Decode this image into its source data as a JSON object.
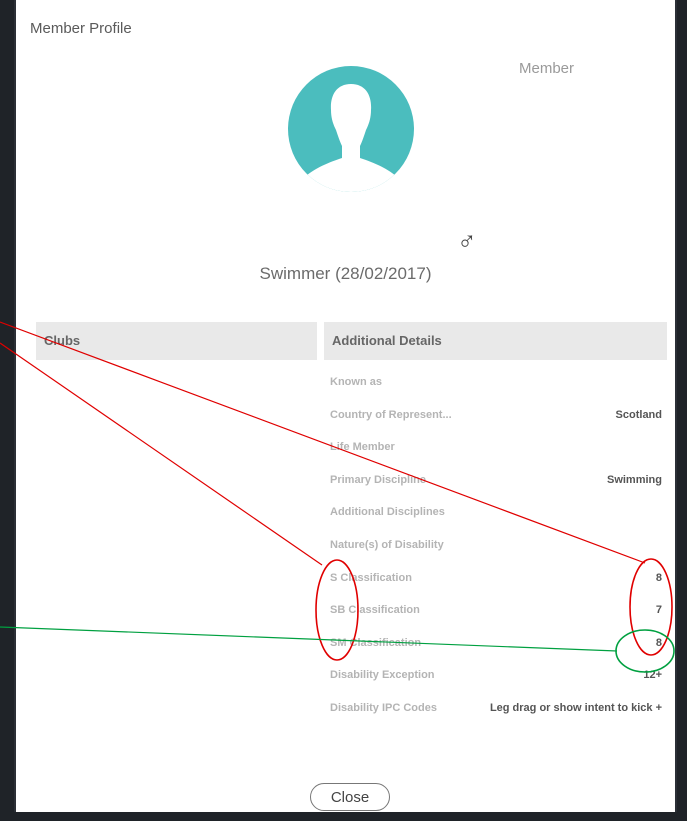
{
  "modal": {
    "title": "Member Profile",
    "role": "Member",
    "gender_symbol": "♂",
    "subtitle": "Swimmer (28/02/2017)"
  },
  "clubs": {
    "heading": "Clubs"
  },
  "details": {
    "heading": "Additional Details",
    "rows": [
      {
        "label": "Known as",
        "value": ""
      },
      {
        "label": "Country of Represent...",
        "value": "Scotland"
      },
      {
        "label": "Life Member",
        "value": ""
      },
      {
        "label": "Primary Discipline",
        "value": "Swimming"
      },
      {
        "label": "Additional Disciplines",
        "value": ""
      },
      {
        "label": "Nature(s) of Disability",
        "value": ""
      },
      {
        "label": "S Classification",
        "value": "8"
      },
      {
        "label": "SB Classification",
        "value": "7"
      },
      {
        "label": "SM Classification",
        "value": "8"
      },
      {
        "label": "Disability Exception",
        "value": "12+"
      },
      {
        "label": "Disability IPC Codes",
        "value": "Leg drag or show intent to kick +"
      }
    ]
  },
  "footer": {
    "close_label": "Close"
  },
  "colors": {
    "avatar_bg": "#4bbdbe",
    "panel_header": "#e9e9e9",
    "annotation_red": "#e00000",
    "annotation_green": "#00a040"
  }
}
